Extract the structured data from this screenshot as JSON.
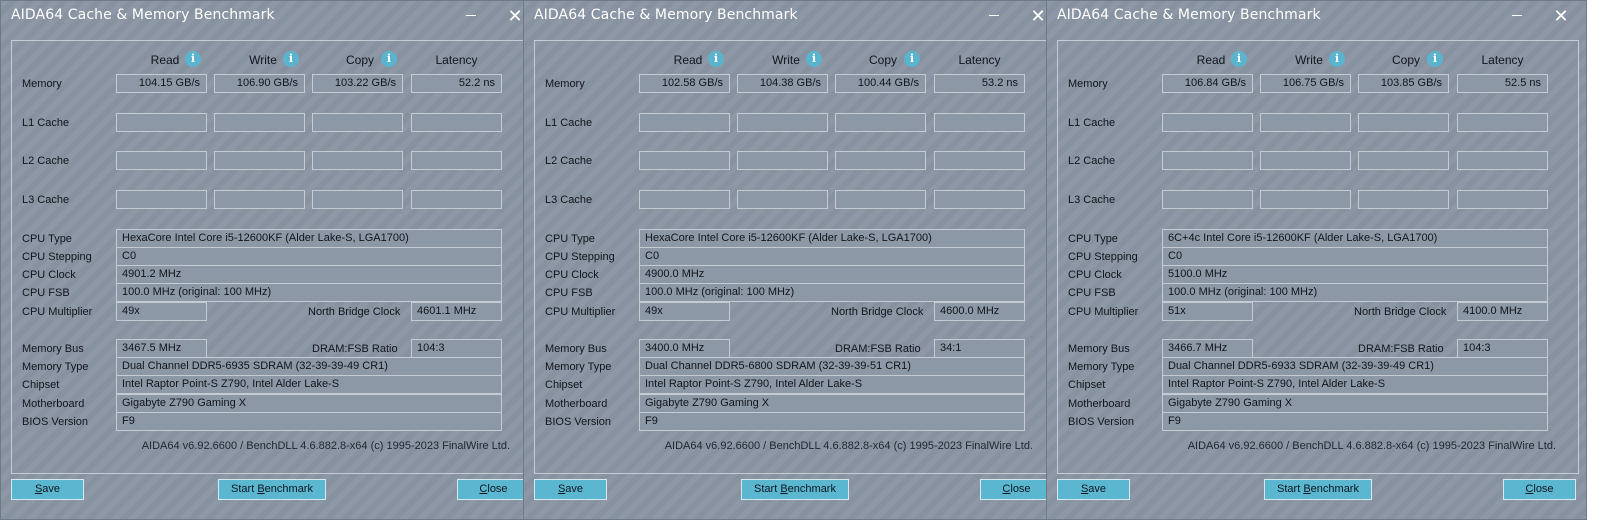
{
  "labels": {
    "read": "Read",
    "write": "Write",
    "copy": "Copy",
    "latency": "Latency",
    "memory": "Memory",
    "l1": "L1 Cache",
    "l2": "L2 Cache",
    "l3": "L3 Cache",
    "cpu_type": "CPU Type",
    "cpu_stepping": "CPU Stepping",
    "cpu_clock": "CPU Clock",
    "cpu_fsb": "CPU FSB",
    "cpu_multiplier": "CPU Multiplier",
    "nb_clock": "North Bridge Clock",
    "memory_bus": "Memory Bus",
    "dram_fsb": "DRAM:FSB Ratio",
    "memory_type": "Memory Type",
    "chipset": "Chipset",
    "motherboard": "Motherboard",
    "bios": "BIOS Version",
    "info_glyph": "i"
  },
  "buttons": {
    "save_prefix": "",
    "save_u": "S",
    "save_rest": "ave",
    "start_prefix": "Start ",
    "start_u": "B",
    "start_rest": "enchmark",
    "close_prefix": "",
    "close_u": "C",
    "close_rest": "lose",
    "close_glyph": "✕"
  },
  "windows": [
    {
      "title": "AIDA64 Cache & Memory Benchmark",
      "memory": {
        "read": "104.15 GB/s",
        "write": "106.90 GB/s",
        "copy": "103.22 GB/s",
        "latency": "52.2 ns"
      },
      "cpu_type": "HexaCore Intel Core i5-12600KF  (Alder Lake-S, LGA1700)",
      "cpu_stepping": "C0",
      "cpu_clock": "4901.2 MHz",
      "cpu_fsb": "100.0 MHz  (original: 100 MHz)",
      "cpu_multiplier": "49x",
      "nb_clock": "4601.1 MHz",
      "memory_bus": "3467.5 MHz",
      "dram_fsb": "104:3",
      "memory_type": "Dual Channel DDR5-6935 SDRAM  (32-39-39-49 CR1)",
      "chipset": "Intel Raptor Point-S Z790, Intel Alder Lake-S",
      "motherboard": "Gigabyte Z790 Gaming X",
      "bios": "F9",
      "footer": "AIDA64 v6.92.6600 / BenchDLL 4.6.882.8-x64  (c) 1995-2023 FinalWire Ltd."
    },
    {
      "title": "AIDA64 Cache & Memory Benchmark",
      "memory": {
        "read": "102.58 GB/s",
        "write": "104.38 GB/s",
        "copy": "100.44 GB/s",
        "latency": "53.2 ns"
      },
      "cpu_type": "HexaCore Intel Core i5-12600KF  (Alder Lake-S, LGA1700)",
      "cpu_stepping": "C0",
      "cpu_clock": "4900.0 MHz",
      "cpu_fsb": "100.0 MHz  (original: 100 MHz)",
      "cpu_multiplier": "49x",
      "nb_clock": "4600.0 MHz",
      "memory_bus": "3400.0 MHz",
      "dram_fsb": "34:1",
      "memory_type": "Dual Channel DDR5-6800 SDRAM  (32-39-39-51 CR1)",
      "chipset": "Intel Raptor Point-S Z790, Intel Alder Lake-S",
      "motherboard": "Gigabyte Z790 Gaming X",
      "bios": "F9",
      "footer": "AIDA64 v6.92.6600 / BenchDLL 4.6.882.8-x64  (c) 1995-2023 FinalWire Ltd."
    },
    {
      "title": "AIDA64 Cache & Memory Benchmark",
      "memory": {
        "read": "106.84 GB/s",
        "write": "106.75 GB/s",
        "copy": "103.85 GB/s",
        "latency": "52.5 ns"
      },
      "cpu_type": "6C+4c Intel Core i5-12600KF  (Alder Lake-S, LGA1700)",
      "cpu_stepping": "C0",
      "cpu_clock": "5100.0 MHz",
      "cpu_fsb": "100.0 MHz  (original: 100 MHz)",
      "cpu_multiplier": "51x",
      "nb_clock": "4100.0 MHz",
      "memory_bus": "3466.7 MHz",
      "dram_fsb": "104:3",
      "memory_type": "Dual Channel DDR5-6933 SDRAM  (32-39-39-49 CR1)",
      "chipset": "Intel Raptor Point-S Z790, Intel Alder Lake-S",
      "motherboard": "Gigabyte Z790 Gaming X",
      "bios": "F9",
      "footer": "AIDA64 v6.92.6600 / BenchDLL 4.6.882.8-x64  (c) 1995-2023 FinalWire Ltd."
    }
  ]
}
